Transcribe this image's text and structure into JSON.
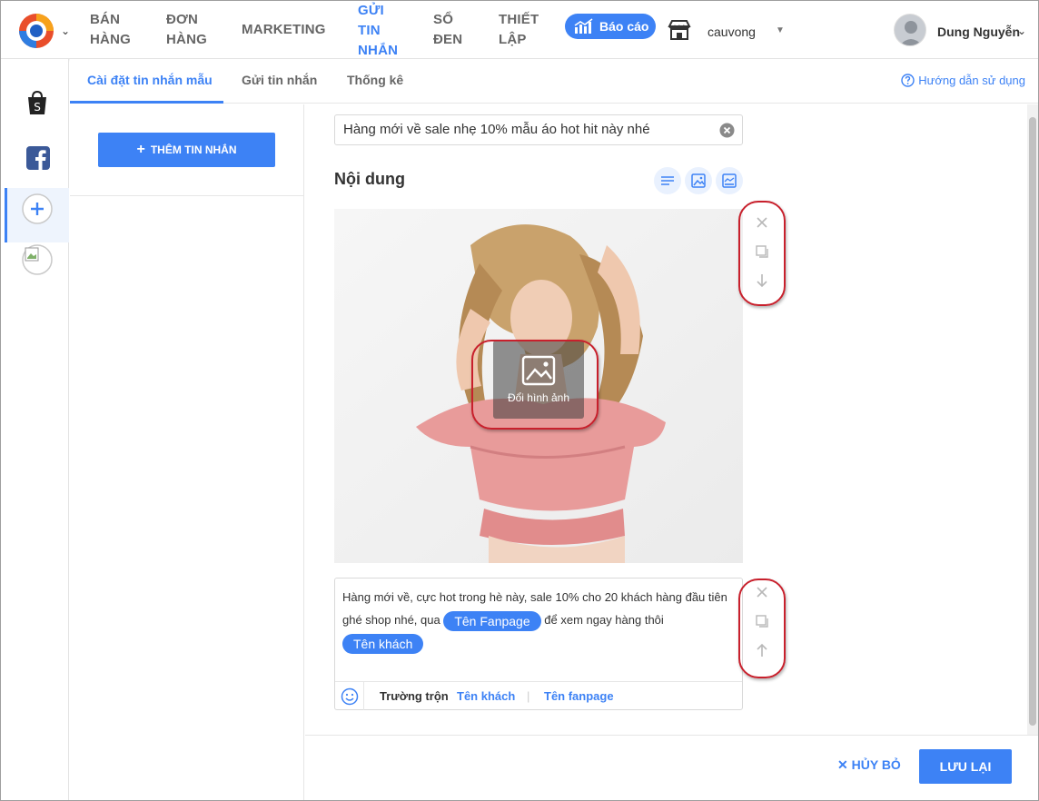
{
  "nav": {
    "items": [
      {
        "line1": "BÁN",
        "line2": "HÀNG"
      },
      {
        "line1": "ĐƠN",
        "line2": "HÀNG"
      },
      {
        "line1": "MARKETING"
      },
      {
        "line1": "GỬI",
        "line2": "TIN",
        "line3": "NHẮN"
      },
      {
        "line1": "SỔ",
        "line2": "ĐEN"
      },
      {
        "line1": "THIẾT",
        "line2": "LẬP"
      }
    ],
    "report_label": "Báo cáo",
    "shop_name": "cauvong",
    "user_name": "Dung Nguyễn"
  },
  "subtabs": {
    "items": [
      "Cài đặt tin nhắn mẫu",
      "Gửi tin nhắn",
      "Thống kê"
    ],
    "help": "Hướng dẫn sử dụng"
  },
  "list": {
    "add_button": "THÊM TIN NHẮN"
  },
  "editor": {
    "title_value": "Hàng mới về sale nhẹ 10% mẫu áo hot hit này nhé",
    "content_label": "Nội dung",
    "change_image_label": "Đổi hình ảnh",
    "message_part1": "Hàng mới về, cực hot trong hè này, sale 10% cho 20 khách hàng đầu tiên ghé shop nhé, qua",
    "chip_fanpage": "Tên Fanpage",
    "message_part2": "để xem ngay hàng thôi",
    "chip_customer": "Tên khách",
    "merge_label": "Trường trộn",
    "merge_customer": "Tên khách",
    "merge_separator": "|",
    "merge_fanpage": "Tên fanpage"
  },
  "actions": {
    "cancel": "HỦY BỎ",
    "save": "LƯU LẠI"
  },
  "colors": {
    "accent": "#3d82f5",
    "highlight_ring": "#c8202c"
  }
}
